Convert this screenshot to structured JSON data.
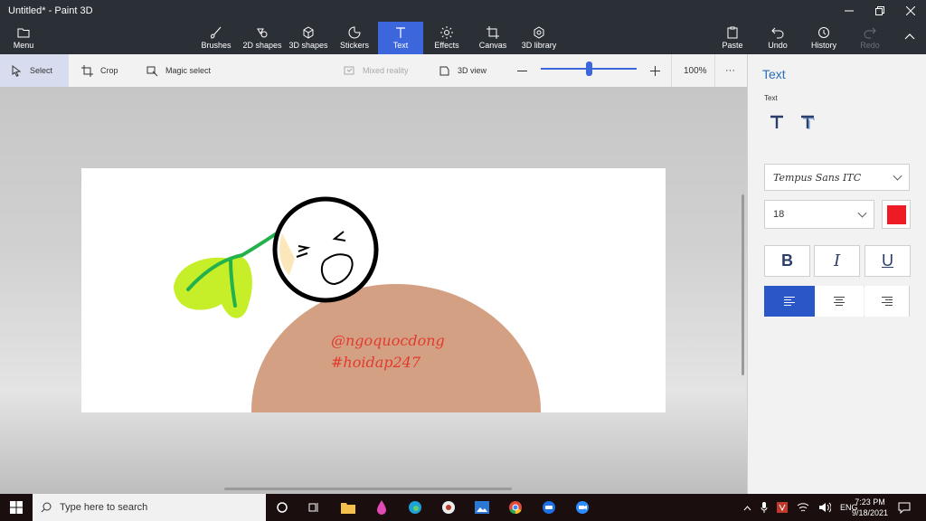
{
  "window": {
    "title": "Untitled* - Paint 3D"
  },
  "ribbon": {
    "menu": "Menu",
    "brushes": "Brushes",
    "shapes2d": "2D shapes",
    "shapes3d": "3D shapes",
    "stickers": "Stickers",
    "text": "Text",
    "effects": "Effects",
    "canvas": "Canvas",
    "library3d": "3D library",
    "paste": "Paste",
    "undo": "Undo",
    "history": "History",
    "redo": "Redo"
  },
  "toolbar": {
    "select": "Select",
    "crop": "Crop",
    "magic_select": "Magic select",
    "mixed_reality": "Mixed reality",
    "view3d": "3D view",
    "zoom": "100%",
    "zoom_level": 0.5,
    "more": "···"
  },
  "canvas": {
    "line1": "@ngoquocdong",
    "line2": "#hoidap247"
  },
  "panel": {
    "title": "Text",
    "subtitle": "Text",
    "font": "Tempus Sans ITC",
    "size": "18",
    "color": "#ed1c24",
    "bold": "B",
    "italic": "I",
    "underline": "U"
  },
  "taskbar": {
    "search_placeholder": "Type here to search",
    "language": "ENG",
    "time": "7:23 PM",
    "date": "9/18/2021"
  }
}
